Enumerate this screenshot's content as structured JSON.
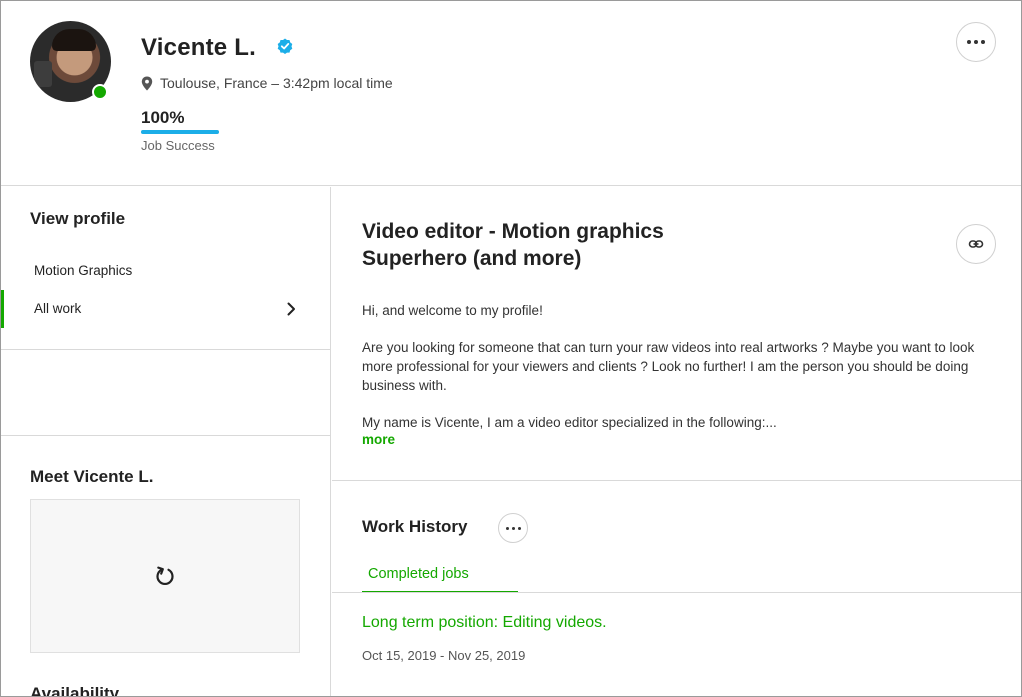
{
  "profile": {
    "name": "Vicente L.",
    "location": "Toulouse, France – 3:42pm local time",
    "job_success_value": "100%",
    "job_success_fraction": 1.0,
    "job_success_label": "Job Success",
    "online_status_color": "#14a800",
    "verified_color": "#1caee8"
  },
  "sidebar": {
    "title": "View profile",
    "items": [
      {
        "label": "Motion Graphics",
        "active": false
      },
      {
        "label": "All work",
        "active": true
      }
    ],
    "meet_title": "Meet Vicente L.",
    "availability_title": "Availability"
  },
  "main": {
    "title_line1": "Video editor - Motion graphics",
    "title_line2": "Superhero (and more)",
    "description": [
      "Hi, and welcome to my profile!",
      "Are you looking for someone that can turn your raw videos into real artworks ? Maybe you want to look more professional for your viewers and clients ? Look no further! I am the person you should be doing business with.",
      "My name is Vicente, I am a video editor specialized in the following:..."
    ],
    "more_label": "more",
    "work_history_title": "Work History",
    "tabs": [
      {
        "label": "Completed jobs"
      }
    ],
    "jobs": [
      {
        "title": "Long term position: Editing videos.",
        "dates": "Oct 15, 2019 - Nov 25, 2019"
      }
    ]
  },
  "colors": {
    "accent": "#14a800",
    "progress": "#1caee8"
  },
  "icons": [
    "verified-badge-icon",
    "location-pin-icon",
    "more-dots-icon",
    "chevron-right-icon",
    "link-icon",
    "reload-icon"
  ]
}
